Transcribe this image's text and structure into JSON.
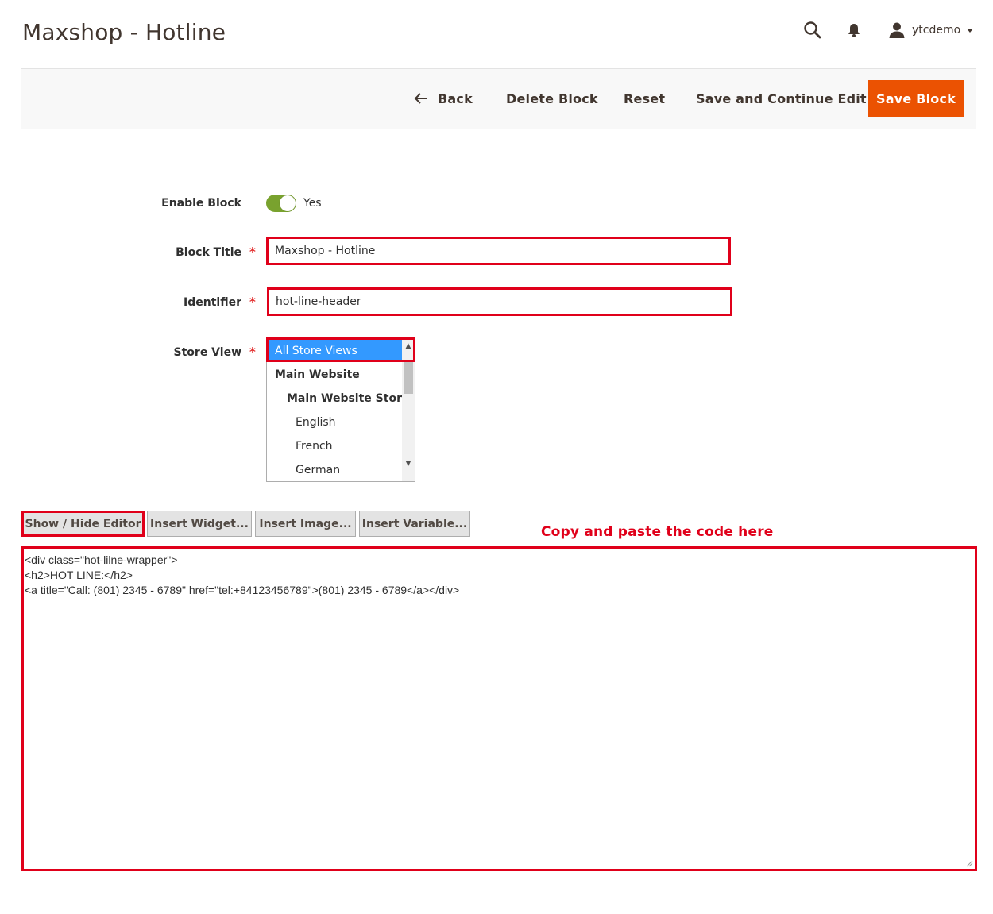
{
  "header": {
    "title": "Maxshop - Hotline",
    "user": "ytcdemo",
    "icons": [
      "search-icon",
      "bell-icon",
      "user-icon",
      "chevron-down-icon"
    ]
  },
  "actions": {
    "back": "Back",
    "delete": "Delete Block",
    "reset": "Reset",
    "save_continue": "Save and Continue Edit",
    "save": "Save Block"
  },
  "form": {
    "enable": {
      "label": "Enable Block",
      "value": "Yes",
      "on": true
    },
    "title": {
      "label": "Block Title",
      "value": "Maxshop - Hotline"
    },
    "identifier": {
      "label": "Identifier",
      "value": "hot-line-header"
    },
    "store_view": {
      "label": "Store View",
      "options": [
        {
          "text": "All Store Views",
          "selected": true,
          "group": false
        },
        {
          "text": "Main Website",
          "selected": false,
          "group": true
        },
        {
          "text": "Main Website Store",
          "selected": false,
          "group": true
        },
        {
          "text": "English",
          "selected": false,
          "group": false
        },
        {
          "text": "French",
          "selected": false,
          "group": false
        },
        {
          "text": "German",
          "selected": false,
          "group": false
        }
      ]
    }
  },
  "editor": {
    "buttons": {
      "show_hide": "Show / Hide Editor",
      "widget": "Insert Widget...",
      "image": "Insert Image...",
      "variable": "Insert Variable..."
    },
    "note": "Copy and paste the code here",
    "code_lines": [
      "<div class=\"hot-lilne-wrapper\">",
      "<h2>HOT LINE:</h2>",
      "<a title=\"Call: (801) 2345 - 6789\" href=\"tel:+84123456789\">(801) 2345 - 6789</a></div>"
    ]
  },
  "colors": {
    "accent": "#eb5202",
    "highlight": "#e0001a",
    "toggle_on": "#79a22e",
    "selection": "#3399ff"
  }
}
